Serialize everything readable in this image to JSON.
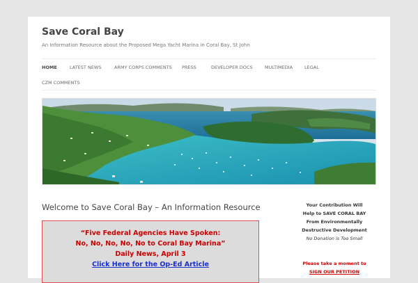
{
  "site": {
    "title": "Save Coral Bay",
    "description": "An Information Resource about the Proposed Mega Yacht Marina in Coral Bay, St John"
  },
  "nav": {
    "items": [
      {
        "label": "HOME",
        "active": true
      },
      {
        "label": "LATEST NEWS"
      },
      {
        "label": "ARMY CORPS COMMENTS"
      },
      {
        "label": "PRESS"
      },
      {
        "label": "DEVELOPER DOCS"
      },
      {
        "label": "MULTIMEDIA"
      },
      {
        "label": "LEGAL"
      },
      {
        "label": "CZM COMMENTS"
      }
    ]
  },
  "main": {
    "post_title": "Welcome to Save Coral Bay – An Information Resource",
    "callout": {
      "line1": "“Five Federal Agencies Have Spoken:",
      "line2": "No, No, No, No, No to Coral Bay Marina”",
      "line3": "Daily News, April 3",
      "link": "Click Here for the Op-Ed Article"
    }
  },
  "sidebar": {
    "line1": "Your Contribution Will",
    "line2": "Help to SAVE CORAL BAY",
    "line3": "From Environmentally",
    "line4": "Destructive Development",
    "line5": "No Donation is Too Small",
    "petition_prompt": "Please take a moment to",
    "petition_link": "SIGN OUR PETITION"
  },
  "colors": {
    "accent_red": "#cc0000",
    "link_blue": "#1a2fd0",
    "callout_bg": "#dcdcdc"
  }
}
